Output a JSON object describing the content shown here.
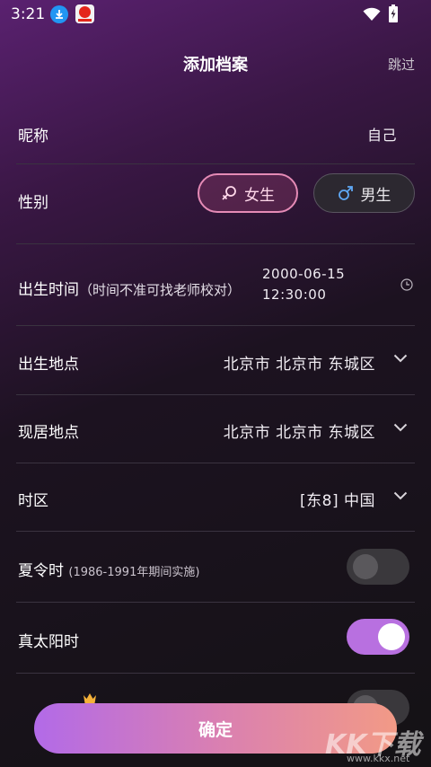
{
  "status_bar": {
    "time": "3:21"
  },
  "header": {
    "title": "添加档案",
    "skip": "跳过"
  },
  "nickname": {
    "label": "昵称",
    "value": "自己"
  },
  "gender": {
    "label": "性别",
    "female": "女生",
    "male": "男生",
    "selected": "female"
  },
  "birth_time": {
    "label": "出生时间",
    "hint": "（时间不准可找老师校对）",
    "date": "2000-06-15",
    "time": "12:30:00"
  },
  "birth_place": {
    "label": "出生地点",
    "value": "北京市 北京市 东城区"
  },
  "current_place": {
    "label": "现居地点",
    "value": "北京市 北京市 东城区"
  },
  "timezone": {
    "label": "时区",
    "value": "[东8] 中国"
  },
  "dst": {
    "label": "夏令时",
    "hint": "(1986-1991年期间实施)",
    "enabled": false
  },
  "true_solar": {
    "label": "真太阳时",
    "enabled": true
  },
  "confirm_label": "确定",
  "watermark": {
    "big": "KK下载",
    "small": "www.kkx.net"
  },
  "colors": {
    "accent_start": "#b26ae8",
    "accent_end": "#f29a86",
    "female_border": "#e58bb6",
    "toggle_on": "#b870e0"
  }
}
